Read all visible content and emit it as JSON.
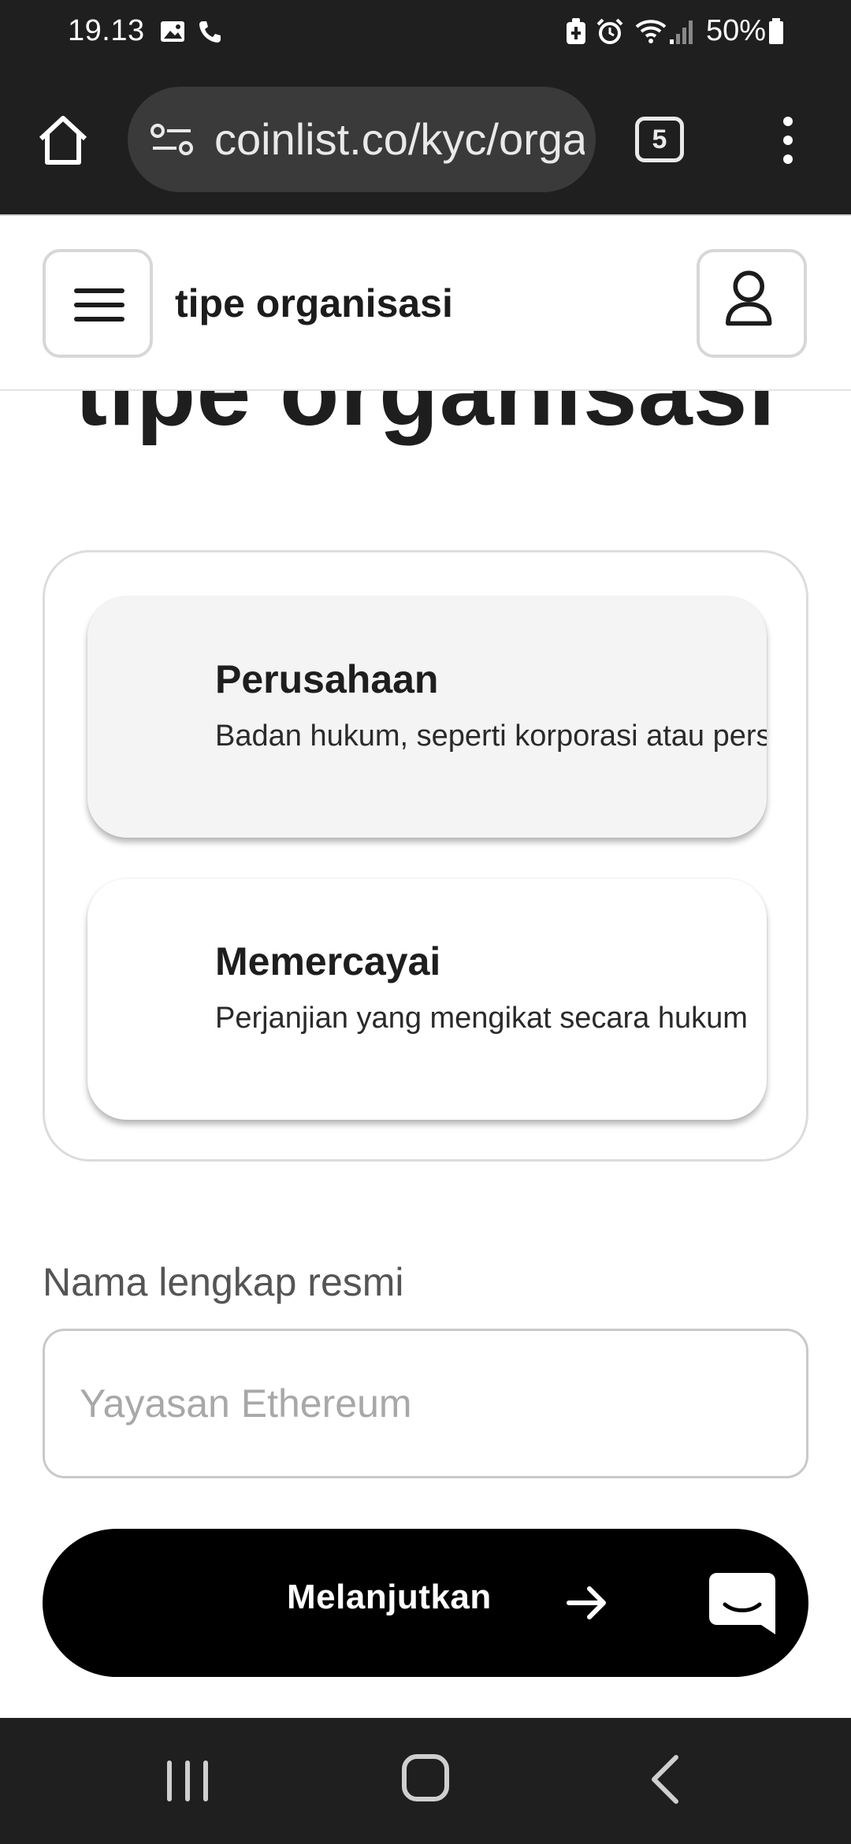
{
  "status_bar": {
    "time": "19.13",
    "battery_percent": "50%"
  },
  "browser": {
    "url": "coinlist.co/kyc/organization",
    "tab_count": "5"
  },
  "header": {
    "title": "tipe organisasi"
  },
  "page": {
    "heading": "tipe organisasi"
  },
  "options": [
    {
      "title": "Perusahaan",
      "description": "Badan hukum, seperti korporasi atau perseroan terbatas",
      "selected": true
    },
    {
      "title": "Memercayai",
      "description": "Perjanjian yang mengikat secara hukum",
      "selected": false
    }
  ],
  "form": {
    "legal_name_label": "Nama lengkap resmi",
    "legal_name_placeholder": "Yayasan Ethereum",
    "legal_name_value": ""
  },
  "actions": {
    "continue_label": "Melanjutkan"
  },
  "colors": {
    "browser_chrome": "#1f1f1f",
    "button": "#000000",
    "selected_option_bg": "#f4f4f4"
  }
}
